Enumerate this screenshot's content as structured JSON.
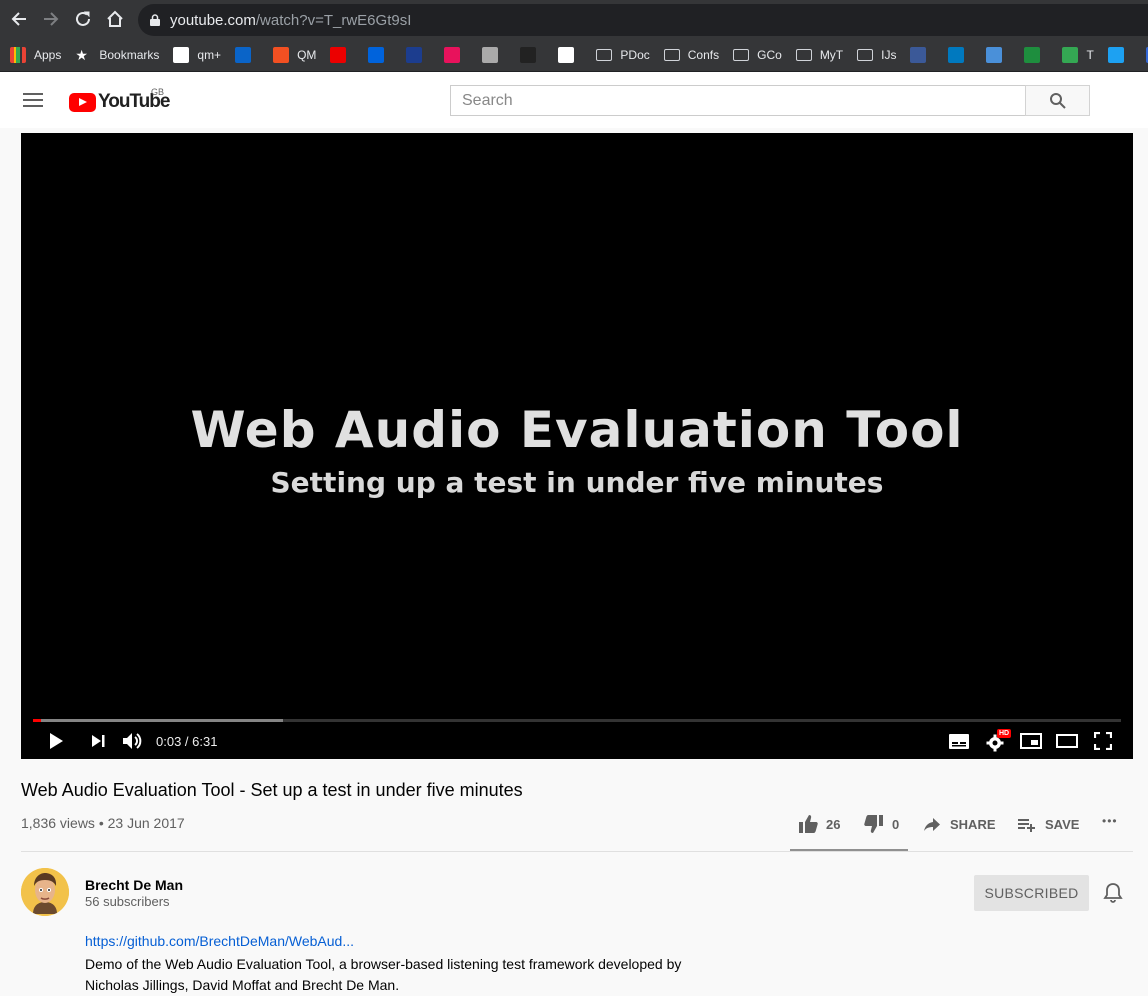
{
  "browser": {
    "url_host": "youtube.com",
    "url_path": "/watch?v=T_rwE6Gt9sI",
    "bookmarks": [
      {
        "label": "Apps",
        "icon": "apps-grid-icon",
        "color": "#4285f4"
      },
      {
        "label": "Bookmarks",
        "icon": "star-icon",
        "color": "#ffffff"
      },
      {
        "label": "qm+",
        "icon": "qmplus-icon",
        "color": "#ffffff"
      },
      {
        "label": "",
        "icon": "outlook-icon",
        "color": "#0a64c8"
      },
      {
        "label": "QM",
        "icon": "microsoft-icon",
        "color": "#f25022"
      },
      {
        "label": "",
        "icon": "santander-icon",
        "color": "#ec0000"
      },
      {
        "label": "",
        "icon": "flickr-dots-icon",
        "color": "#0063dc"
      },
      {
        "label": "",
        "icon": "blue-square-icon",
        "color": "#1c3d8e"
      },
      {
        "label": "",
        "icon": "play-triangle-icon",
        "color": "#e8125c"
      },
      {
        "label": "",
        "icon": "channel4-icon",
        "color": "#aaaaaa"
      },
      {
        "label": "",
        "icon": "itv-icon",
        "color": "#222222"
      },
      {
        "label": "",
        "icon": "puzzle-icon",
        "color": "#ffffff"
      },
      {
        "label": "PDoc",
        "icon": "folder-icon",
        "color": "#d0d3d8"
      },
      {
        "label": "Confs",
        "icon": "folder-icon",
        "color": "#d0d3d8"
      },
      {
        "label": "GCo",
        "icon": "folder-icon",
        "color": "#d0d3d8"
      },
      {
        "label": "MyT",
        "icon": "folder-icon",
        "color": "#d0d3d8"
      },
      {
        "label": "IJs",
        "icon": "folder-icon",
        "color": "#d0d3d8"
      },
      {
        "label": "",
        "icon": "facebook-icon",
        "color": "#3b5998"
      },
      {
        "label": "",
        "icon": "trello-icon",
        "color": "#0079bf"
      },
      {
        "label": "",
        "icon": "graduation-cap-icon",
        "color": "#4a90d9"
      },
      {
        "label": "",
        "icon": "chameleon-icon",
        "color": "#1e8e3e"
      },
      {
        "label": "T",
        "icon": "leaf-icon",
        "color": "#34a853"
      },
      {
        "label": "",
        "icon": "twitter-icon",
        "color": "#1da1f2"
      },
      {
        "label": "",
        "icon": "calendar-7-icon",
        "color": "#3367d6"
      }
    ]
  },
  "yt": {
    "logo_text": "YouTube",
    "region": "GB",
    "search_placeholder": "Search"
  },
  "video": {
    "overlay_title": "Web Audio Evaluation Tool",
    "overlay_subtitle": "Setting up a test in under five minutes",
    "time": "0:03 / 6:31",
    "played_fraction": 0.0077,
    "buffered_fraction": 0.23,
    "hd_badge": "HD"
  },
  "info": {
    "title": "Web Audio Evaluation Tool - Set up a test in under five minutes",
    "meta": "1,836 views • 23 Jun 2017",
    "likes": "26",
    "dislikes": "0",
    "share": "SHARE",
    "save": "SAVE",
    "more": "•••"
  },
  "channel": {
    "name": "Brecht De Man",
    "subscribers": "56 subscribers",
    "subscribe_label": "SUBSCRIBED"
  },
  "description": {
    "link": "https://github.com/BrechtDeMan/WebAud...",
    "text": "Demo of the Web Audio Evaluation Tool, a browser-based listening test framework developed by Nicholas Jillings, David Moffat and Brecht De Man."
  }
}
